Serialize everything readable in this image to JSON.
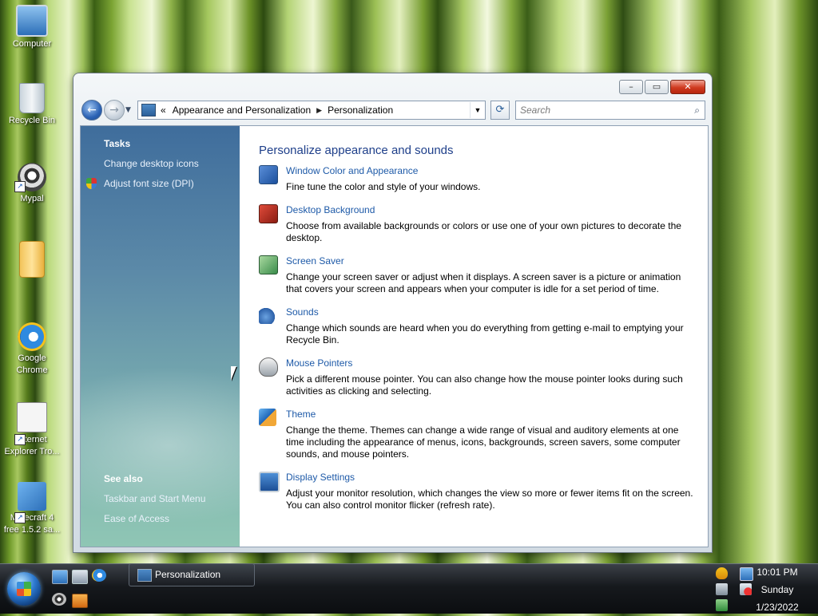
{
  "desktop": {
    "icons": [
      {
        "label": "Computer",
        "icon": "computer-icon"
      },
      {
        "label": "Recycle Bin",
        "icon": "recycle-bin-icon"
      },
      {
        "label": "Mypal",
        "icon": "mypal-icon"
      },
      {
        "label": "",
        "icon": "folder-icon"
      },
      {
        "label": "Google\nChrome",
        "icon": "ie-icon"
      },
      {
        "label": "Internet\nExplorer Tro...",
        "icon": "mypal-icon"
      },
      {
        "label": "Minecraft 4\nfree 1.5.2 sa...",
        "icon": "network-icon"
      }
    ]
  },
  "window": {
    "title": "Personalization",
    "controls": {
      "minimize": "–",
      "maximize": "▭",
      "close": "✕"
    },
    "address": {
      "overflow": "«",
      "crumbs": [
        "Appearance and Personalization",
        "Personalization"
      ]
    },
    "search": {
      "placeholder": "Search"
    }
  },
  "sidebar": {
    "tasks_heading": "Tasks",
    "tasks": [
      "Change desktop icons",
      "Adjust font size (DPI)"
    ],
    "see_also_heading": "See also",
    "see_also": [
      "Taskbar and Start Menu",
      "Ease of Access"
    ]
  },
  "main": {
    "heading": "Personalize appearance and sounds",
    "items": [
      {
        "title": "Window Color and Appearance",
        "desc": "Fine tune the color and style of your windows.",
        "icon": "window-color-icon"
      },
      {
        "title": "Desktop Background",
        "desc": "Choose from available backgrounds or colors or use one of your own pictures to decorate the desktop.",
        "icon": "desktop-background-icon"
      },
      {
        "title": "Screen Saver",
        "desc": "Change your screen saver or adjust when it displays. A screen saver is a picture or animation that covers your screen and appears when your computer is idle for a set period of time.",
        "icon": "screen-saver-icon"
      },
      {
        "title": "Sounds",
        "desc": "Change which sounds are heard when you do everything from getting e-mail to emptying your Recycle Bin.",
        "icon": "sounds-icon"
      },
      {
        "title": "Mouse Pointers",
        "desc": "Pick a different mouse pointer. You can also change how the mouse pointer looks during such activities as clicking and selecting.",
        "icon": "mouse-pointer-icon"
      },
      {
        "title": "Theme",
        "desc": "Change the theme. Themes can change a wide range of visual and auditory elements at one time including the appearance of menus, icons, backgrounds, screen savers, some computer sounds, and mouse pointers.",
        "icon": "theme-icon"
      },
      {
        "title": "Display Settings",
        "desc": "Adjust your monitor resolution, which changes the view so more or fewer items fit on the screen. You can also control monitor flicker (refresh rate).",
        "icon": "display-settings-icon"
      }
    ]
  },
  "taskbar": {
    "button_label": "Personalization",
    "clock": {
      "time": "10:01 PM",
      "day": "Sunday",
      "date": "1/23/2022"
    }
  },
  "colors": {
    "link": "#1e5aa8",
    "heading": "#1e3f8a",
    "sidebar_top": "#3f6d9c",
    "sidebar_bottom": "#8fc6b4"
  }
}
